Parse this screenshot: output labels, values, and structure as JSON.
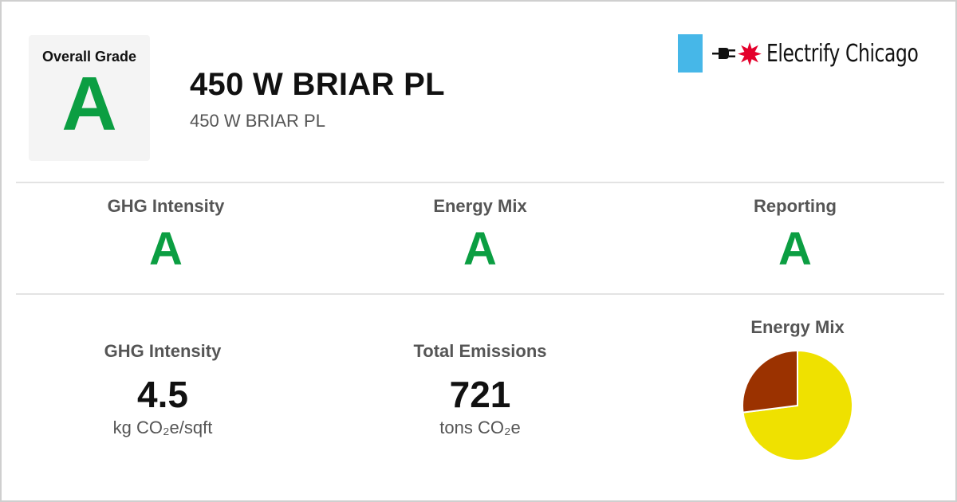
{
  "header": {
    "overall_grade_label": "Overall Grade",
    "overall_grade": "A",
    "title": "450 W BRIAR PL",
    "subtitle": "450 W BRIAR PL"
  },
  "logo": {
    "text": "Electrify Chicago",
    "colors": {
      "blue": "#46b7e8",
      "star": "#e4002b"
    },
    "icons": [
      "plug-icon",
      "star-icon"
    ]
  },
  "grades": [
    {
      "label": "GHG Intensity",
      "value": "A"
    },
    {
      "label": "Energy Mix",
      "value": "A"
    },
    {
      "label": "Reporting",
      "value": "A"
    }
  ],
  "metrics": {
    "ghg": {
      "label": "GHG Intensity",
      "value": "4.5",
      "unit": "kg CO₂e/sqft"
    },
    "emissions": {
      "label": "Total Emissions",
      "value": "721",
      "unit": "tons CO₂e"
    }
  },
  "energy_mix": {
    "label": "Energy Mix"
  },
  "colors": {
    "grade_green": "#0b9e42",
    "pie_electric": "#efe100",
    "pie_gas": "#9b3200"
  },
  "chart_data": {
    "type": "pie",
    "values": [
      73,
      27
    ],
    "colors": [
      "#efe100",
      "#9b3200"
    ],
    "legend": "none"
  }
}
